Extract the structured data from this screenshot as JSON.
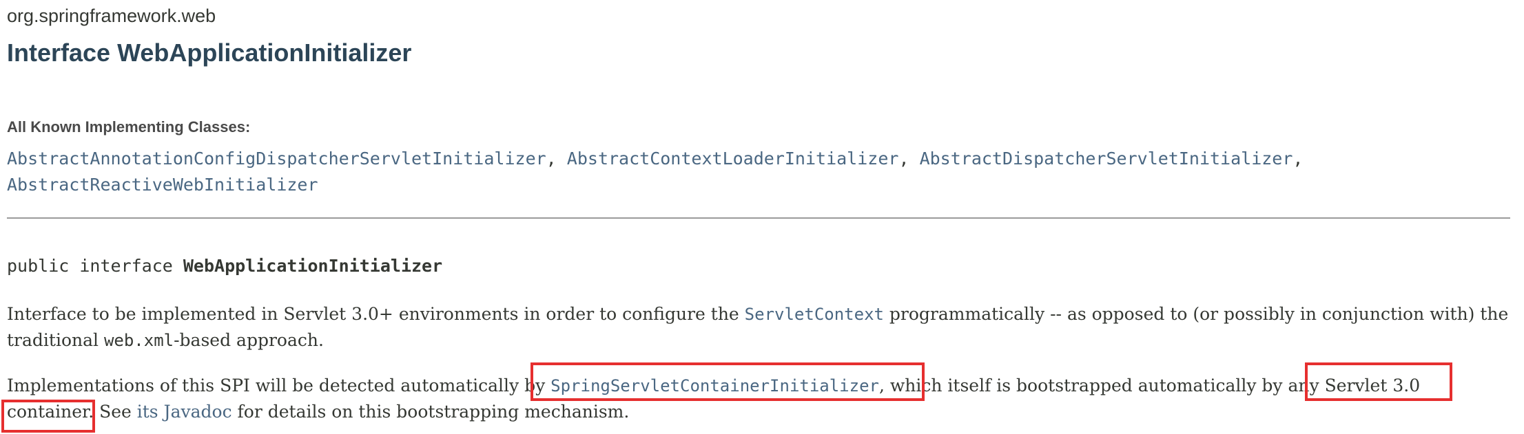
{
  "package_name": "org.springframework.web",
  "interface_title": "Interface WebApplicationInitializer",
  "known_classes": {
    "label": "All Known Implementing Classes:",
    "items": [
      "AbstractAnnotationConfigDispatcherServletInitializer",
      "AbstractContextLoaderInitializer",
      "AbstractDispatcherServletInitializer",
      "AbstractReactiveWebInitializer"
    ],
    "separator": ","
  },
  "signature": {
    "prefix": "public interface ",
    "name": "WebApplicationInitializer"
  },
  "description": {
    "p1": {
      "text_a": "Interface to be implemented in Servlet 3.0+ environments in order to configure the ",
      "link": "ServletContext",
      "text_b": " programmatically -- as opposed to (or possibly in conjunction with) the",
      "text_c": "traditional ",
      "code": "web.xml",
      "text_d": "-based approach."
    },
    "p2": {
      "text_a": "Implementations of this SPI will be detected automatically by ",
      "link": "SpringServletContainerInitializer",
      "text_b": ", which itself is bootstrapped automatically by any Servlet 3.0",
      "text_c": "container. See ",
      "link2": "its Javadoc",
      "text_d": " for details on this bootstrapping mechanism."
    }
  },
  "colors": {
    "link": "#4a6782",
    "title": "#2c4557",
    "body_text": "#353833",
    "highlight_box": "#e62f2f"
  }
}
